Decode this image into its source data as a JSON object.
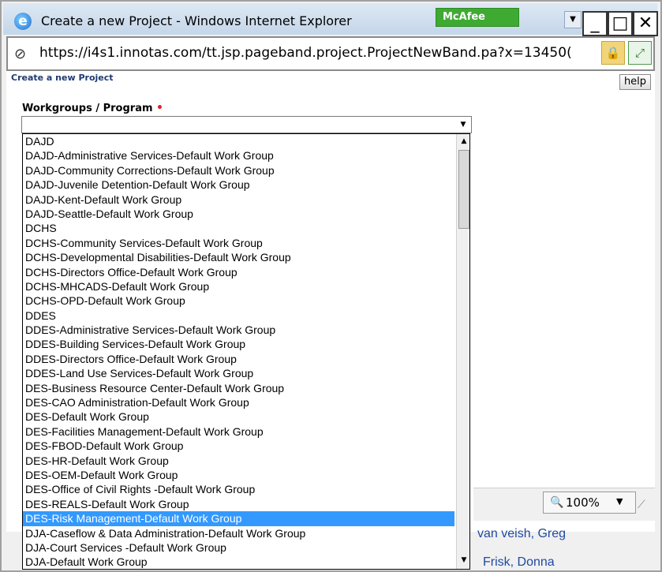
{
  "window": {
    "title": "Create a new Project - Windows Internet Explorer",
    "mcafee_label": "McAfee",
    "minimize_glyph": "_",
    "maximize_glyph": "□",
    "close_glyph": "✕"
  },
  "address_bar": {
    "url": "https://i4s1.innotas.com/tt.jsp.pageband.project.ProjectNewBand.pa?x=13450("
  },
  "page": {
    "heading": "Create a new Project",
    "help_label": "help",
    "field_label": "Workgroups / Program",
    "required_marker": "•",
    "select_value": ""
  },
  "dropdown": {
    "selected_index": 26,
    "options": [
      "DAJD",
      "DAJD-Administrative Services-Default Work Group",
      "DAJD-Community Corrections-Default Work Group",
      "DAJD-Juvenile Detention-Default Work Group",
      "DAJD-Kent-Default Work Group",
      "DAJD-Seattle-Default Work Group",
      "DCHS",
      "DCHS-Community Services-Default Work Group",
      "DCHS-Developmental Disabilities-Default Work Group",
      "DCHS-Directors Office-Default Work Group",
      "DCHS-MHCADS-Default Work Group",
      "DCHS-OPD-Default Work Group",
      "DDES",
      "DDES-Administrative Services-Default Work Group",
      "DDES-Building Services-Default Work Group",
      "DDES-Directors Office-Default Work Group",
      "DDES-Land Use Services-Default Work Group",
      "DES-Business Resource Center-Default Work Group",
      "DES-CAO Administration-Default Work Group",
      "DES-Default Work Group",
      "DES-Facilities Management-Default Work Group",
      "DES-FBOD-Default Work Group",
      "DES-HR-Default Work Group",
      "DES-OEM-Default Work Group",
      "DES-Office of Civil Rights -Default Work Group",
      "DES-REALS-Default Work Group",
      "DES-Risk Management-Default Work Group",
      "DJA-Caseflow & Data Administration-Default Work Group",
      "DJA-Court Services -Default Work Group",
      "DJA-Default Work Group"
    ]
  },
  "status": {
    "zoom": "100%"
  },
  "background_page": {
    "name_1": "van veish, Greg",
    "name_2": "Frisk, Donna"
  },
  "colors": {
    "selection": "#3399ff",
    "mcafee_green": "#3faa32",
    "link_blue": "#1f4aa0"
  }
}
